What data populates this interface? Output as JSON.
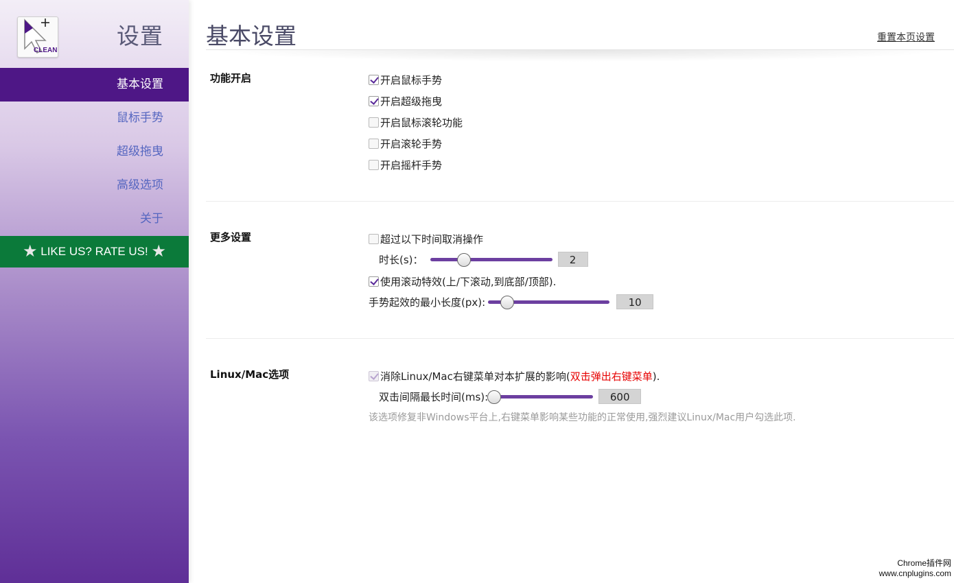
{
  "sidebar": {
    "title": "设置",
    "logo_text": "CLEAN",
    "items": [
      {
        "label": "基本设置",
        "active": true
      },
      {
        "label": "鼠标手势",
        "active": false
      },
      {
        "label": "超级拖曳",
        "active": false
      },
      {
        "label": "高级选项",
        "active": false
      },
      {
        "label": "关于",
        "active": false
      }
    ],
    "rate_banner": "LIKE US? RATE US!"
  },
  "header": {
    "title": "基本设置",
    "reset_label": "重置本页设置"
  },
  "sections": {
    "features": {
      "title": "功能开启",
      "options": [
        {
          "label": "开启鼠标手势",
          "checked": true
        },
        {
          "label": "开启超级拖曳",
          "checked": true
        },
        {
          "label": "开启鼠标滚轮功能",
          "checked": false
        },
        {
          "label": "开启滚轮手势",
          "checked": false
        },
        {
          "label": "开启摇杆手势",
          "checked": false
        }
      ]
    },
    "more": {
      "title": "更多设置",
      "timeout_label": "超过以下时间取消操作",
      "timeout_checked": false,
      "duration_label": "时长(s)：",
      "duration_value": "2",
      "scroll_effect_label": "使用滚动特效(上/下滚动,到底部/顶部).",
      "scroll_effect_checked": true,
      "min_length_label": "手势起效的最小长度(px):",
      "min_length_value": "10"
    },
    "linux": {
      "title": "Linux/Mac选项",
      "fix_label": "消除Linux/Mac右键菜单对本扩展的影响(",
      "fix_label_red": "双击弹出右键菜单",
      "fix_label_end": ").",
      "fix_checked": true,
      "interval_label": "双击间隔最长时间(ms):",
      "interval_value": "600",
      "note": "该选项修复非Windows平台上,右键菜单影响某些功能的正常使用,强烈建议Linux/Mac用户勾选此项."
    }
  },
  "watermark": {
    "line1": "Chrome插件网",
    "line2": "www.cnplugins.com"
  },
  "colors": {
    "nav_active_bg": "#4e1786",
    "nav_link": "#5566c0",
    "rate_banner_bg": "#0b7a3a",
    "slider_track": "#6c3fa0",
    "highlight_red": "#e60000"
  }
}
